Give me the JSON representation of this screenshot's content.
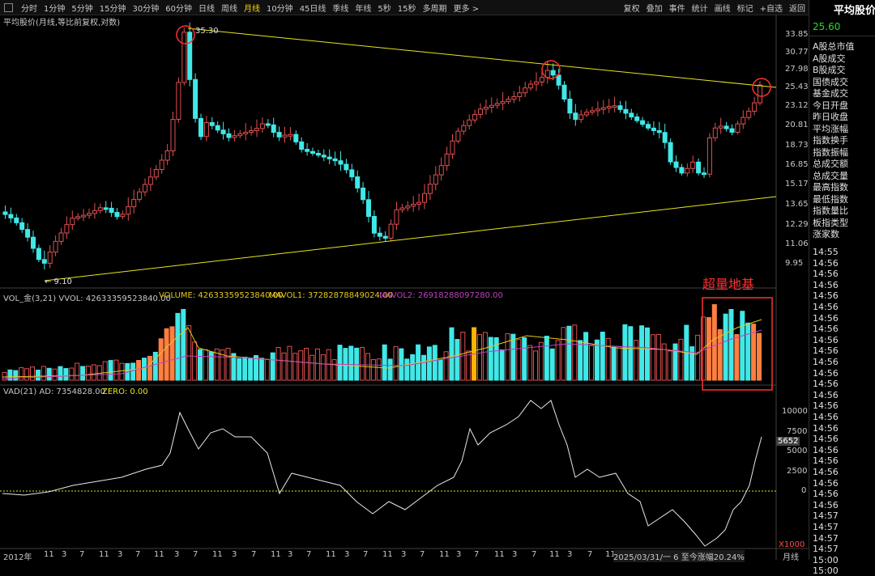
{
  "toolbar": {
    "left": [
      "分时",
      "1分钟",
      "5分钟",
      "15分钟",
      "30分钟",
      "60分钟",
      "日线",
      "周线",
      "月线",
      "10分钟",
      "45日线",
      "季线",
      "年线",
      "5秒",
      "15秒",
      "多周期",
      "更多 >"
    ],
    "active": "月线",
    "right": [
      "复权",
      "叠加",
      "事件",
      "统计",
      "画线",
      "标记",
      "+自选",
      "返回"
    ]
  },
  "chart_title": "平均股价(月线,等比前复权,对数)",
  "price_axis": [
    "33.85",
    "30.77",
    "27.98",
    "25.43",
    "23.12",
    "20.81",
    "18.73",
    "16.85",
    "15.17",
    "13.65",
    "12.29",
    "11.06",
    "9.95"
  ],
  "price_markers": {
    "high": "35.30",
    "low": "9.10"
  },
  "volume": {
    "header_left": "VOL_金(3,21)  VVOL: 42633359523840.00",
    "volume_label": "VOLUME: 42633359523840.00",
    "mavol1": "MAVOL1: 37282878849024.00",
    "mavol2": "MAVOL2: 26918288097280.00",
    "annotation": "超量地基"
  },
  "vad": {
    "header": "VAD(21)  AD: 7354828.00",
    "zero": "ZERO: 0.00",
    "axis": [
      "10000",
      "7500",
      "5000",
      "2500",
      "0"
    ],
    "current": "5652",
    "unit": "X1000"
  },
  "time_axis": [
    "2012年",
    "11",
    "3",
    "7",
    "11",
    "3",
    "7",
    "11",
    "3",
    "7",
    "11",
    "3",
    "7",
    "11",
    "3",
    "7",
    "11",
    "3",
    "7",
    "11",
    "3",
    "7",
    "11",
    "3",
    "7",
    "11",
    "3",
    "7",
    "11",
    "3",
    "7",
    "11",
    "3",
    "7",
    "11",
    "3",
    "7",
    "11",
    "3",
    "7",
    "11",
    "3",
    "7"
  ],
  "status_text": "2025/03/31/一 6 至今涨幅20.24%",
  "period_label": "月线",
  "sidebar": {
    "title": "平均股价",
    "value": "25.60",
    "items": [
      "A股总市值",
      "A股成交",
      "B股成交",
      "国债成交",
      "基金成交",
      "今日开盘",
      "昨日收盘",
      "平均涨幅",
      "指数换手",
      "指数振幅",
      "总成交额",
      "总成交量",
      "最高指数",
      "最低指数",
      "指数量比",
      "板指类型",
      "涨家数"
    ],
    "times": [
      "14:55",
      "14:56",
      "14:56",
      "14:56",
      "14:56",
      "14:56",
      "14:56",
      "14:56",
      "14:56",
      "14:56",
      "14:56",
      "14:56",
      "14:56",
      "14:56",
      "14:56",
      "14:56",
      "14:56",
      "14:56",
      "14:56",
      "14:56",
      "14:56",
      "14:56",
      "14:56",
      "14:56",
      "14:57",
      "14:57",
      "14:57",
      "14:57",
      "15:00",
      "15:00"
    ]
  },
  "colors": {
    "up": "#e05050",
    "down": "#40e8e8",
    "trend": "#e6e61e",
    "circle": "#ff3030",
    "ma1": "#e6c81e",
    "ma2": "#c040c0",
    "orange": "#ff7f40",
    "gold": "#ffb400"
  }
}
